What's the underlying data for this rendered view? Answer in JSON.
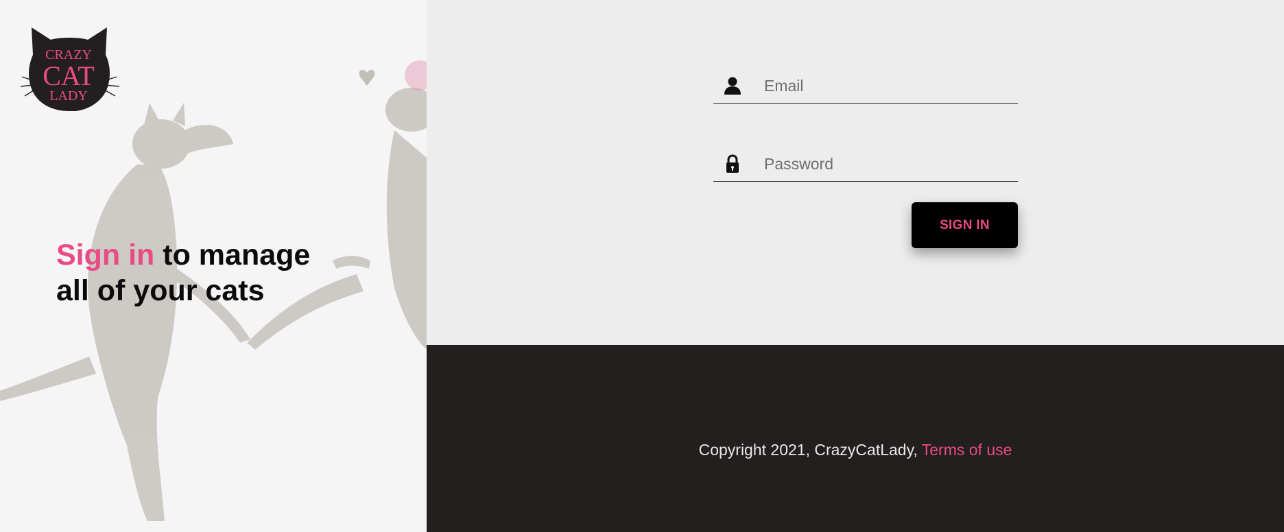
{
  "brand": {
    "logo_line1": "CRAZY",
    "logo_line2": "CAT",
    "logo_line3": "LADY"
  },
  "hero": {
    "highlight": "Sign in",
    "rest_line1": " to manage",
    "line2": "all of your cats"
  },
  "form": {
    "email_placeholder": "Email",
    "password_placeholder": "Password",
    "email_icon": "user-icon",
    "password_icon": "lock-icon",
    "submit_label": "SIGN IN"
  },
  "footer": {
    "copyright": "Copyright 2021, CrazyCatLady, ",
    "terms_label": "Terms of use"
  },
  "colors": {
    "accent": "#e84b85",
    "footer_bg": "#221f1e",
    "panel_bg": "#ededed"
  }
}
